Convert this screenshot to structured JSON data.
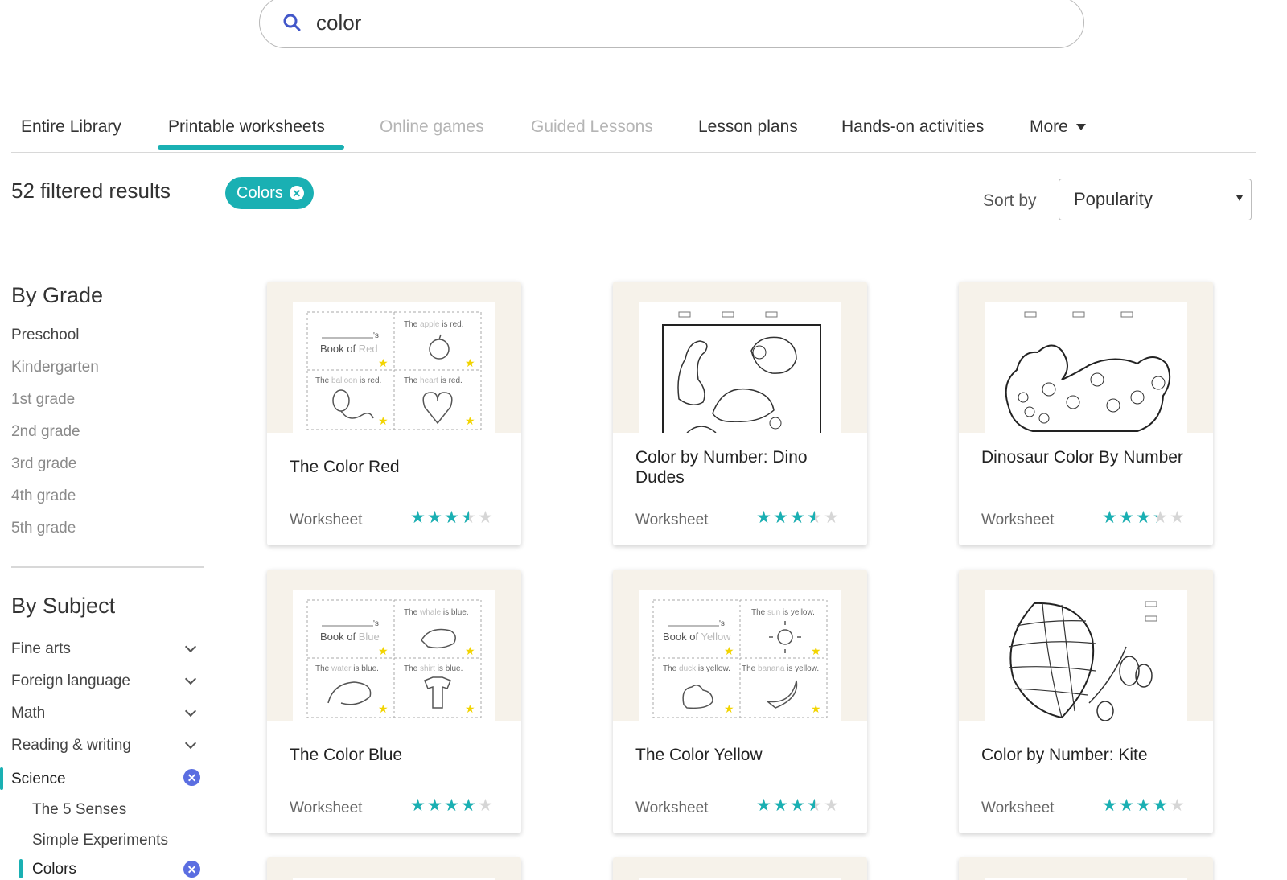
{
  "search": {
    "query": "color"
  },
  "tabs": [
    {
      "label": "Entire Library",
      "disabled": false
    },
    {
      "label": "Printable worksheets",
      "disabled": false,
      "active": true
    },
    {
      "label": "Online games",
      "disabled": true
    },
    {
      "label": "Guided Lessons",
      "disabled": true
    },
    {
      "label": "Lesson plans",
      "disabled": false
    },
    {
      "label": "Hands-on activities",
      "disabled": false
    },
    {
      "label": "More",
      "disabled": false
    }
  ],
  "results": {
    "count_text": "52 filtered results",
    "chip_label": "Colors"
  },
  "sort": {
    "label": "Sort by",
    "value": "Popularity"
  },
  "sidebar": {
    "grade_heading": "By Grade",
    "grades": [
      "Preschool",
      "Kindergarten",
      "1st grade",
      "2nd grade",
      "3rd grade",
      "4th grade",
      "5th grade"
    ],
    "subject_heading": "By Subject",
    "subjects": [
      "Fine arts",
      "Foreign language",
      "Math",
      "Reading & writing"
    ],
    "active_subject": "Science",
    "subtopics": [
      "The 5 Senses",
      "Simple Experiments"
    ],
    "active_subtopic": "Colors"
  },
  "colors": {
    "accent": "#1ab0b3",
    "remove": "#5b6ee1",
    "thumb_bg": "#f6f2ea"
  },
  "cards": [
    {
      "title": "The Color Red",
      "type": "Worksheet",
      "rating": 3.5
    },
    {
      "title": "Color by Number: Dino Dudes",
      "type": "Worksheet",
      "rating": 3.5
    },
    {
      "title": "Dinosaur Color By Number",
      "type": "Worksheet",
      "rating": 3.3
    },
    {
      "title": "The Color Blue",
      "type": "Worksheet",
      "rating": 4.0
    },
    {
      "title": "The Color Yellow",
      "type": "Worksheet",
      "rating": 3.5
    },
    {
      "title": "Color by Number: Kite",
      "type": "Worksheet",
      "rating": 4.0
    }
  ],
  "thumbs": {
    "red": {
      "book": "Book of ",
      "color": "Red",
      "s": "'s",
      "c1": "The ",
      "c1b": "apple",
      "c1c": " is red.",
      "c2": "The ",
      "c2b": "balloon",
      "c2c": " is red.",
      "c3": "The ",
      "c3b": "heart",
      "c3c": " is red."
    },
    "blue": {
      "book": "Book of ",
      "color": "Blue",
      "s": "'s",
      "c1": "The ",
      "c1b": "whale",
      "c1c": " is blue.",
      "c2": "The ",
      "c2b": "water",
      "c2c": " is blue.",
      "c3": "The ",
      "c3b": "shirt",
      "c3c": " is blue."
    },
    "yellow": {
      "book": "Book of ",
      "color": "Yellow",
      "s": "'s",
      "c1": "The ",
      "c1b": "sun",
      "c1c": " is yellow.",
      "c2": "The ",
      "c2b": "duck",
      "c2c": " is yellow.",
      "c3": "The ",
      "c3b": "banana",
      "c3c": " is yellow."
    }
  }
}
